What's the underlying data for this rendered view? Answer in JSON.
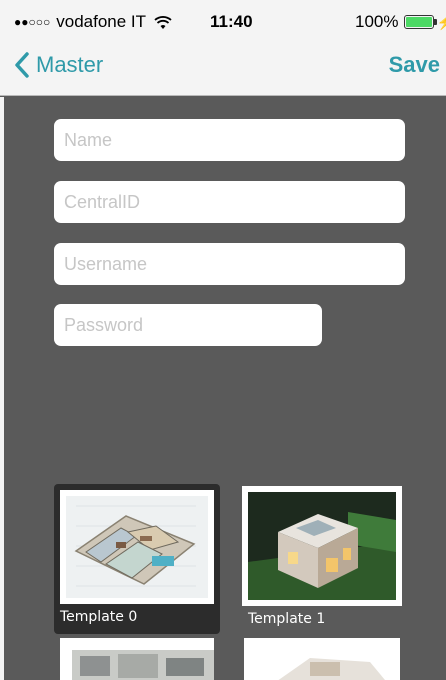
{
  "status_bar": {
    "carrier": "vodafone IT",
    "time": "11:40",
    "battery": "100%",
    "battery_color": "#4cd964"
  },
  "nav": {
    "back_label": "Master",
    "save_label": "Save",
    "accent_color": "#2f9aa9"
  },
  "form": {
    "name": {
      "value": "",
      "placeholder": "Name"
    },
    "central_id": {
      "value": "",
      "placeholder": "CentralID"
    },
    "username": {
      "value": "",
      "placeholder": "Username"
    },
    "password": {
      "value": "",
      "placeholder": "Password"
    }
  },
  "templates": [
    {
      "label": "Template 0",
      "selected": true
    },
    {
      "label": "Template 1",
      "selected": false
    }
  ]
}
